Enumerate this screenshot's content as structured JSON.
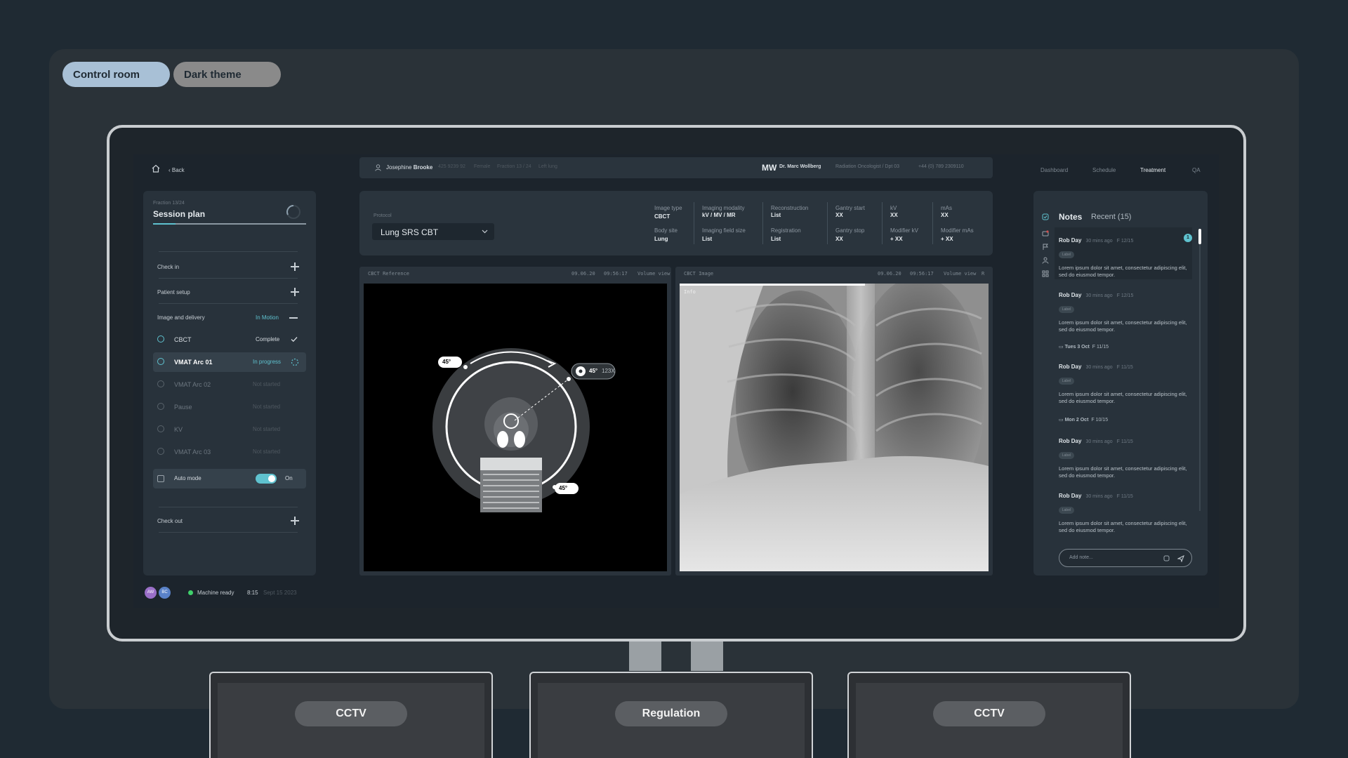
{
  "chips": {
    "control_room": "Control room",
    "dark_theme": "Dark theme"
  },
  "lower_screens": [
    {
      "label": "CCTV"
    },
    {
      "label": "Regulation"
    },
    {
      "label": "CCTV"
    }
  ],
  "topnav": {
    "back": "Back",
    "items": [
      "Dashboard",
      "Schedule",
      "Treatment",
      "QA"
    ],
    "active": "Treatment"
  },
  "patient": {
    "first": "Josephine",
    "last": "Brooke",
    "id": "425 9239 92",
    "sex": "Female",
    "fraction": "Fraction 13 / 24",
    "site": "Left lung"
  },
  "clinician": {
    "initials": "MW",
    "name": "Dr. Marc Wollberg",
    "role": "Radiation Oncologist / Dpt 03",
    "phone": "+44 (0) 789 2309110"
  },
  "session": {
    "fraction": "Fraction 13/24",
    "title": "Session plan",
    "check_in": "Check in",
    "patient_setup": "Patient setup",
    "image_delivery": {
      "label": "Image and delivery",
      "status": "In Motion"
    },
    "steps": [
      {
        "label": "CBCT",
        "status": "Complete"
      },
      {
        "label": "VMAT Arc 01",
        "status": "In progress"
      },
      {
        "label": "VMAT Arc 02",
        "status": "Not started"
      },
      {
        "label": "Pause",
        "status": "Not started"
      },
      {
        "label": "KV",
        "status": "Not started"
      },
      {
        "label": "VMAT Arc 03",
        "status": "Not started"
      }
    ],
    "auto_mode": {
      "label": "Auto mode",
      "state": "On"
    },
    "check_out": "Check out"
  },
  "status": {
    "avatars": [
      "AW",
      "BC"
    ],
    "machine": "Machine ready",
    "time": "8:15",
    "date": "Sept 15 2023"
  },
  "protocol": {
    "label": "Protocol",
    "value": "Lung SRS CBT",
    "fields": [
      {
        "label": "Image type",
        "value": "CBCT"
      },
      {
        "label": "Body site",
        "value": "Lung"
      },
      {
        "label": "Imaging modality",
        "value": "kV / MV / MR"
      },
      {
        "label": "Imaging field size",
        "value": "List"
      },
      {
        "label": "Reconstruction",
        "value": "List"
      },
      {
        "label": "Registration",
        "value": "List"
      },
      {
        "label": "Gantry start",
        "value": "XX"
      },
      {
        "label": "Gantry stop",
        "value": "XX"
      },
      {
        "label": "kV",
        "value": "XX"
      },
      {
        "label": "Modifier kV",
        "value": "+ XX"
      },
      {
        "label": "mAs",
        "value": "XX"
      },
      {
        "label": "Modifier mAs",
        "value": "+ XX"
      }
    ]
  },
  "viewer_left": {
    "title": "CBCT Reference",
    "date": "09.06.20",
    "time": "09:56:17",
    "mode": "Volume view",
    "angle_top": "45°",
    "angle_bottom": "45°",
    "beam": "45°",
    "beam_value": "123X"
  },
  "viewer_right": {
    "title": "CBCT Image",
    "date": "09.06.20",
    "time": "09:56:17",
    "mode": "Volume view",
    "extra": "R",
    "info": "Info",
    "progress": 0.6
  },
  "notes": {
    "title": "Notes",
    "recent": "Recent (15)",
    "badge": "1",
    "label_chip": "Label",
    "days": [
      "Tues 3 Oct",
      "Mon 2 Oct"
    ],
    "day_meta": [
      "F 11/15",
      "F 10/15"
    ],
    "items": [
      {
        "author": "Rob Day",
        "ago": "30 mins ago",
        "fraction": "F 12/15",
        "text": "Lorem ipsum dolor sit amet, consectetur adipiscing elit, sed do eiusmod tempor."
      },
      {
        "author": "Rob Day",
        "ago": "30 mins ago",
        "fraction": "F 12/15",
        "text": "Lorem ipsum dolor sit amet, consectetur adipiscing elit, sed do eiusmod tempor."
      },
      {
        "author": "Rob Day",
        "ago": "30 mins ago",
        "fraction": "F 11/15",
        "text": "Lorem ipsum dolor sit amet, consectetur adipiscing elit, sed do eiusmod tempor."
      },
      {
        "author": "Rob Day",
        "ago": "30 mins ago",
        "fraction": "F 11/15",
        "text": "Lorem ipsum dolor sit amet, consectetur adipiscing elit, sed do eiusmod tempor."
      },
      {
        "author": "Rob Day",
        "ago": "30 mins ago",
        "fraction": "F 11/15",
        "text": "Lorem ipsum dolor sit amet, consectetur adipiscing elit, sed do eiusmod tempor."
      }
    ],
    "input_placeholder": "Add note..."
  },
  "colors": {
    "accent": "#5fc2cf",
    "ready": "#3fd06b"
  }
}
